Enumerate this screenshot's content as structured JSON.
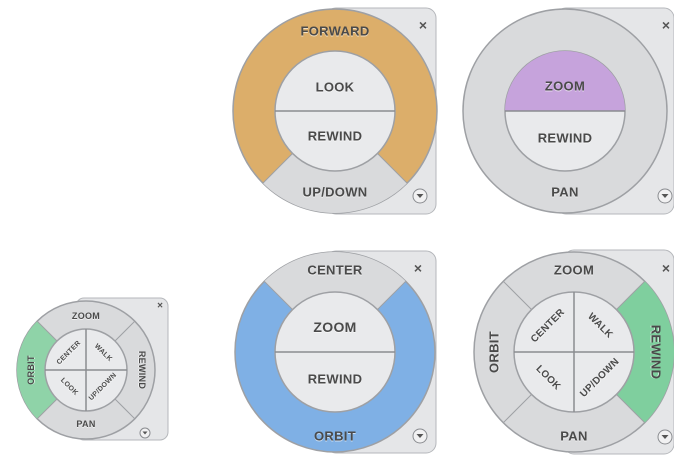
{
  "accent": {
    "orange": "#dcae6a",
    "purple": "#c6a3dc",
    "blue": "#7fb0e5",
    "green": "#7fcf9e",
    "gray": "#d6d7da"
  },
  "icons": {
    "close": "close-icon",
    "menu": "menu-icon"
  },
  "wheel_small": {
    "zoom": "ZOOM",
    "rewind": "REWIND",
    "pan": "PAN",
    "orbit": "ORBIT",
    "center": "CENTER",
    "walk": "WALK",
    "look": "LOOK",
    "updown": "UP/DOWN",
    "close": "×"
  },
  "wheel_forward": {
    "forward": "FORWARD",
    "look": "LOOK",
    "rewind": "REWIND",
    "updown": "UP/DOWN",
    "close": "×"
  },
  "wheel_zoom_top": {
    "zoom": "ZOOM",
    "rewind": "REWIND",
    "pan": "PAN",
    "close": "×"
  },
  "wheel_center": {
    "center": "CENTER",
    "zoom": "ZOOM",
    "rewind": "REWIND",
    "orbit": "ORBIT",
    "close": "×"
  },
  "wheel_full": {
    "zoom": "ZOOM",
    "rewind": "REWIND",
    "pan": "PAN",
    "orbit": "ORBIT",
    "center": "CENTER",
    "walk": "WALK",
    "look": "LOOK",
    "updown": "UP/DOWN",
    "close": "×"
  }
}
